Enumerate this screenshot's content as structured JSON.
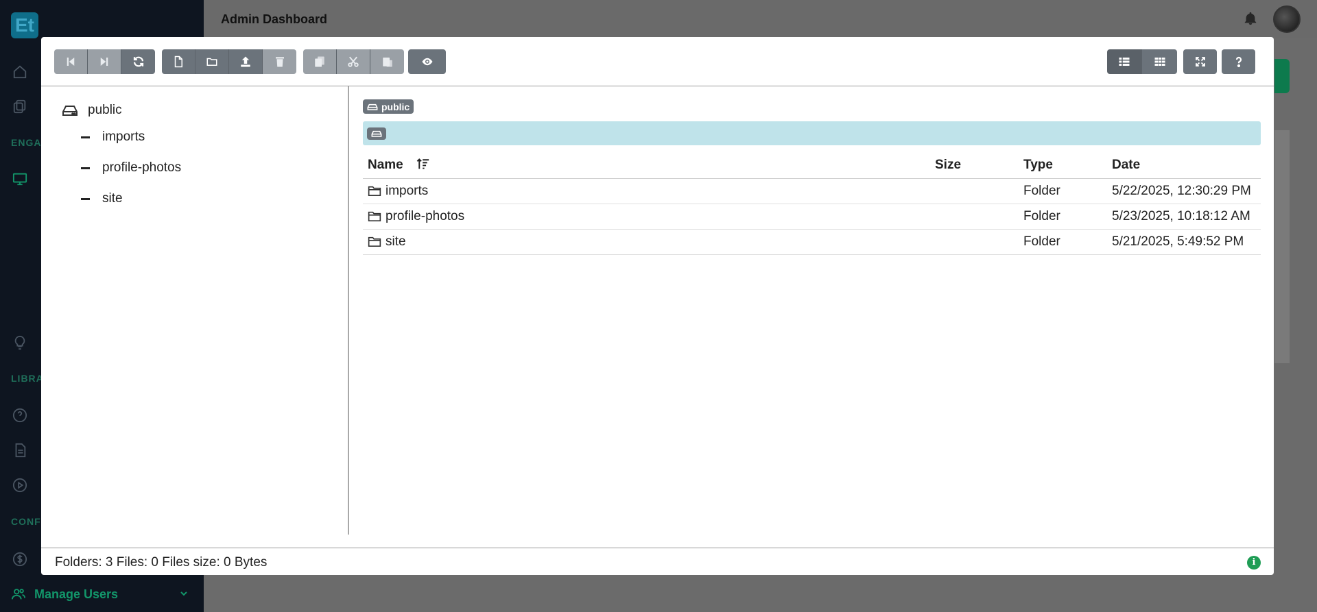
{
  "app": {
    "title": "Admin Dashboard",
    "logo_text": "Et",
    "sidebar_sections": [
      "ENGA",
      "LIBRA",
      "CONF"
    ],
    "sidebar_footer_item": "Manage Users"
  },
  "colors": {
    "accent_green": "#12966a",
    "toolbar_button": "#6b737b",
    "path_bar": "#bfe3ea",
    "info": "#1f9d55"
  },
  "toolbar": {
    "groups": [
      [
        {
          "name": "go-back-button",
          "icon": "step-backward-icon",
          "disabled": true
        },
        {
          "name": "go-forward-button",
          "icon": "step-forward-icon",
          "disabled": true
        },
        {
          "name": "refresh-button",
          "icon": "sync-icon",
          "disabled": false
        }
      ],
      [
        {
          "name": "new-file-button",
          "icon": "file-icon",
          "disabled": false
        },
        {
          "name": "new-folder-button",
          "icon": "folder-icon",
          "disabled": false
        },
        {
          "name": "upload-button",
          "icon": "upload-icon",
          "disabled": false
        },
        {
          "name": "delete-button",
          "icon": "trash-icon",
          "disabled": true
        }
      ],
      [
        {
          "name": "copy-button",
          "icon": "copy-icon",
          "disabled": true
        },
        {
          "name": "cut-button",
          "icon": "scissors-icon",
          "disabled": true
        },
        {
          "name": "paste-button",
          "icon": "paste-icon",
          "disabled": true
        }
      ],
      [
        {
          "name": "preview-button",
          "icon": "eye-icon",
          "disabled": false
        }
      ]
    ],
    "right_groups": [
      [
        {
          "name": "table-view-button",
          "icon": "list-icon",
          "active": true
        },
        {
          "name": "grid-view-button",
          "icon": "grid-icon",
          "active": false
        }
      ],
      [
        {
          "name": "fullscreen-button",
          "icon": "expand-icon"
        }
      ],
      [
        {
          "name": "help-button",
          "icon": "question-icon"
        }
      ]
    ]
  },
  "tree": {
    "root": "public",
    "children": [
      "imports",
      "profile-photos",
      "site"
    ]
  },
  "breadcrumb": {
    "disk": "public"
  },
  "table": {
    "columns": {
      "name": "Name",
      "size": "Size",
      "type": "Type",
      "date": "Date"
    },
    "rows": [
      {
        "name": "imports",
        "size": "",
        "type": "Folder",
        "date": "5/22/2025, 12:30:29 PM"
      },
      {
        "name": "profile-photos",
        "size": "",
        "type": "Folder",
        "date": "5/23/2025, 10:18:12 AM"
      },
      {
        "name": "site",
        "size": "",
        "type": "Folder",
        "date": "5/21/2025, 5:49:52 PM"
      }
    ]
  },
  "status": {
    "summary": "Folders: 3 Files: 0 Files size: 0 Bytes"
  }
}
